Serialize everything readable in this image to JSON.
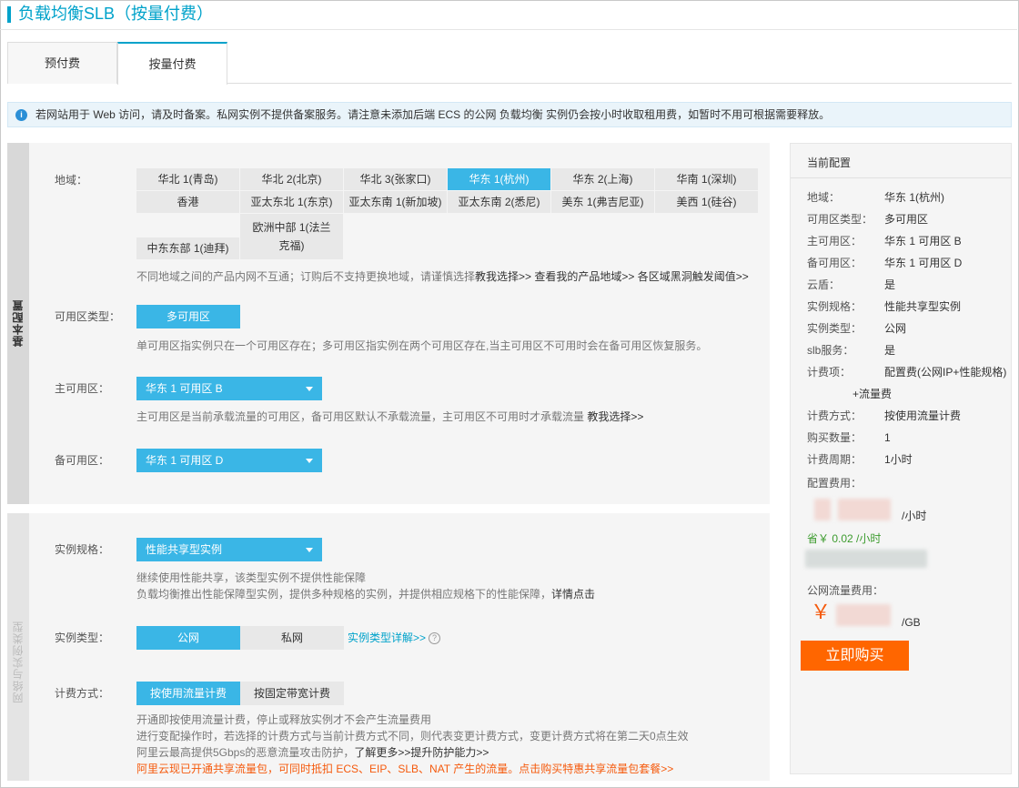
{
  "header": {
    "title": "负载均衡SLB（按量付费）"
  },
  "tabs": [
    {
      "label": "预付费"
    },
    {
      "label": "按量付费"
    }
  ],
  "notice": {
    "text": "若网站用于 Web 访问，请及时备案。私网实例不提供备案服务。请注意未添加后端 ECS 的公网 负载均衡 实例仍会按小时收取租用费，如暂时不用可根据需要释放。"
  },
  "basic": {
    "side_label": "基本配置",
    "region": {
      "label": "地域：",
      "rows": [
        [
          "华北 1(青岛)",
          "华北 2(北京)",
          "华北 3(张家口)",
          "华东 1(杭州)",
          "华东 2(上海)",
          "华南 1(深圳)"
        ],
        [
          "香港",
          "亚太东北 1(东京)",
          "亚太东南 1(新加坡)",
          "亚太东南 2(悉尼)",
          "美东 1(弗吉尼亚)",
          "美西 1(硅谷)"
        ],
        [
          "中东东部 1(迪拜)",
          "欧洲中部 1(法兰克福)"
        ]
      ],
      "hint": "不同地域之间的产品内网不互通；订购后不支持更换地域，请谨慎选择",
      "hint_links": "教我选择>> 查看我的产品地域>> 各区域黑洞触发阈值>>"
    },
    "zone_type": {
      "label": "可用区类型：",
      "value": "多可用区",
      "hint": "单可用区指实例只在一个可用区存在；多可用区指实例在两个可用区存在,当主可用区不可用时会在备可用区恢复服务。"
    },
    "primary_zone": {
      "label": "主可用区：",
      "value": "华东 1 可用区 B",
      "hint": "主可用区是当前承载流量的可用区，备可用区默认不承载流量，主可用区不可用时才承载流量",
      "hint_link": "教我选择>>"
    },
    "backup_zone": {
      "label": "备可用区：",
      "value": "华东 1 可用区 D"
    }
  },
  "network": {
    "side_label": "网络与实例类型",
    "spec": {
      "label": "实例规格：",
      "value": "性能共享型实例",
      "hint1": "继续使用性能共享，该类型实例不提供性能保障",
      "hint2": "负载均衡推出性能保障型实例，提供多种规格的实例，并提供相应规格下的性能保障，",
      "hint2_link": "详情点击"
    },
    "instance_type": {
      "label": "实例类型：",
      "options": [
        "公网",
        "私网"
      ],
      "link": "实例类型详解>>",
      "help": "?"
    },
    "billing": {
      "label": "计费方式：",
      "options": [
        "按使用流量计费",
        "按固定带宽计费"
      ],
      "hint1": "开通即按使用流量计费，停止或释放实例才不会产生流量费用",
      "hint2": "进行变配操作时，若选择的计费方式与当前计费方式不同，则代表变更计费方式，变更计费方式将在第二天0点生效",
      "hint3": "阿里云最高提供5Gbps的恶意流量攻击防护，",
      "hint3_link": "了解更多>>提升防护能力>>",
      "hint4": "阿里云现已开通共享流量包，可同时抵扣 ECS、EIP、SLB、NAT 产生的流量。点击购买特惠共享流量包套餐>>"
    }
  },
  "summary": {
    "title": "当前配置",
    "rows": [
      {
        "k": "地域：",
        "v": "华东 1(杭州)"
      },
      {
        "k": "可用区类型：",
        "v": "多可用区"
      },
      {
        "k": "主可用区：",
        "v": "华东 1 可用区 B"
      },
      {
        "k": "备可用区：",
        "v": "华东 1 可用区 D"
      },
      {
        "k": "云盾：",
        "v": "是"
      },
      {
        "k": "实例规格：",
        "v": "性能共享型实例"
      },
      {
        "k": "实例类型：",
        "v": "公网"
      },
      {
        "k": "slb服务：",
        "v": "是"
      },
      {
        "k": "计费项：",
        "v": "配置费(公网IP+性能规格)"
      },
      {
        "k": "",
        "v": "+流量费"
      },
      {
        "k": "计费方式：",
        "v": "按使用流量计费"
      },
      {
        "k": "购买数量：",
        "v": "1"
      },
      {
        "k": "计费周期：",
        "v": "1小时"
      }
    ],
    "config_fee_label": "配置费用：",
    "config_fee_unit": "/小时",
    "save": "省￥ 0.02 /小时",
    "traffic_fee_label": "公网流量费用：",
    "yen": "￥",
    "traffic_unit": "/GB",
    "buy_label": "立即购买",
    "colors": {
      "accent": "#3ab6e6",
      "buy": "#ff6600",
      "save": "#3c9b2e"
    }
  }
}
